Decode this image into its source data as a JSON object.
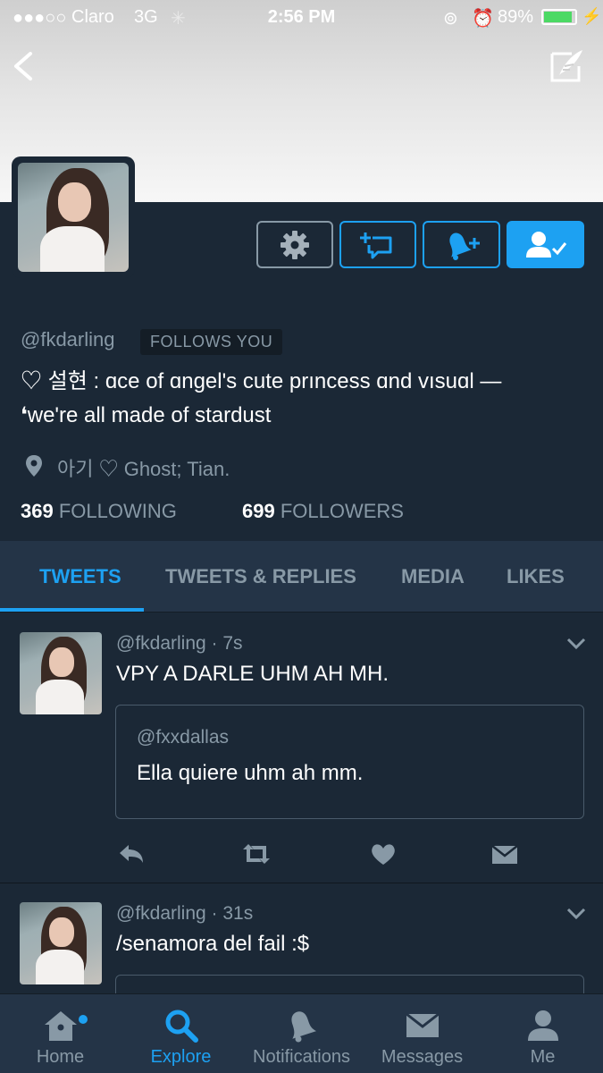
{
  "status_bar": {
    "signal": "●●●○○",
    "carrier": "Claro",
    "network": "3G",
    "time": "2:56 PM",
    "battery_percent": "89%",
    "battery_level": 0.89
  },
  "profile": {
    "handle": "@fkdarling",
    "follows_you": "FOLLOWS YOU",
    "bio_line1": "♡ 설현 : ɑce of ɑngel's cute prıncess ɑnd vısuɑl —",
    "bio_line2": "❛we're all made of stardust",
    "location": "아기 ♡ Ghost; Tian.",
    "following_count": "369",
    "following_label": "FOLLOWING",
    "followers_count": "699",
    "followers_label": "FOLLOWERS"
  },
  "tabs": [
    {
      "label": "TWEETS",
      "active": true
    },
    {
      "label": "TWEETS & REPLIES",
      "active": false
    },
    {
      "label": "MEDIA",
      "active": false
    },
    {
      "label": "LIKES",
      "active": false
    }
  ],
  "tweets": [
    {
      "handle": "@fkdarling",
      "time": "· 7s",
      "text": "VPY A DARLE UHM AH MH.",
      "quote": {
        "handle": "@fxxdallas",
        "text": "Ella quiere uhm ah mm."
      }
    },
    {
      "handle": "@fkdarling",
      "time": "· 31s",
      "text": "/senamora del fail :$"
    }
  ],
  "bottom_nav": [
    {
      "label": "Home",
      "icon": "home-icon",
      "active": false
    },
    {
      "label": "Explore",
      "icon": "search-icon",
      "active": true
    },
    {
      "label": "Notifications",
      "icon": "bell-icon",
      "active": false
    },
    {
      "label": "Messages",
      "icon": "envelope-icon",
      "active": false
    },
    {
      "label": "Me",
      "icon": "person-icon",
      "active": false
    }
  ],
  "colors": {
    "background": "#1b2836",
    "accent": "#1da1f2",
    "muted": "#8899a6",
    "tab_bar": "#243447"
  }
}
